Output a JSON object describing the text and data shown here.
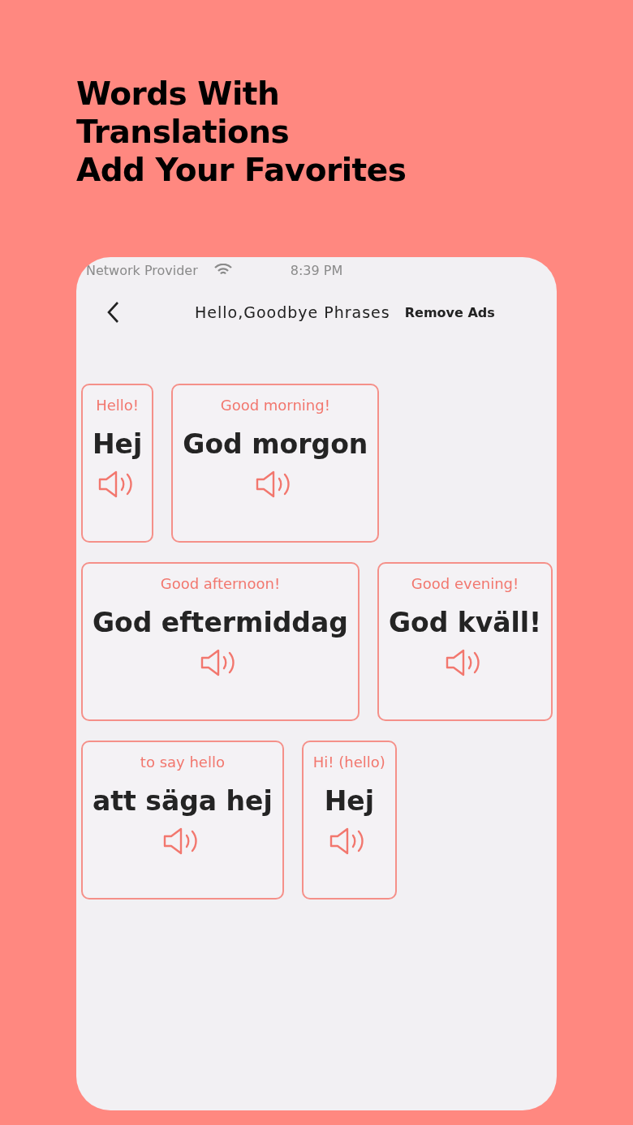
{
  "headline": [
    "Words With",
    "Translations",
    "Add Your Favorites"
  ],
  "status_bar": {
    "carrier": "Network Provider",
    "time": "8:39 PM"
  },
  "nav": {
    "title": "Hello,Goodbye Phrases",
    "action": "Remove Ads"
  },
  "cards": [
    {
      "translation": "Hello!",
      "word": "Hej"
    },
    {
      "translation": "Good morning!",
      "word": "God morgon"
    },
    {
      "translation": "Good afternoon!",
      "word": "God eftermiddag"
    },
    {
      "translation": "Good evening!",
      "word": "God kväll!"
    },
    {
      "translation": "to say hello",
      "word": "att säga hej"
    },
    {
      "translation": "Hi! (hello)",
      "word": "Hej"
    }
  ]
}
